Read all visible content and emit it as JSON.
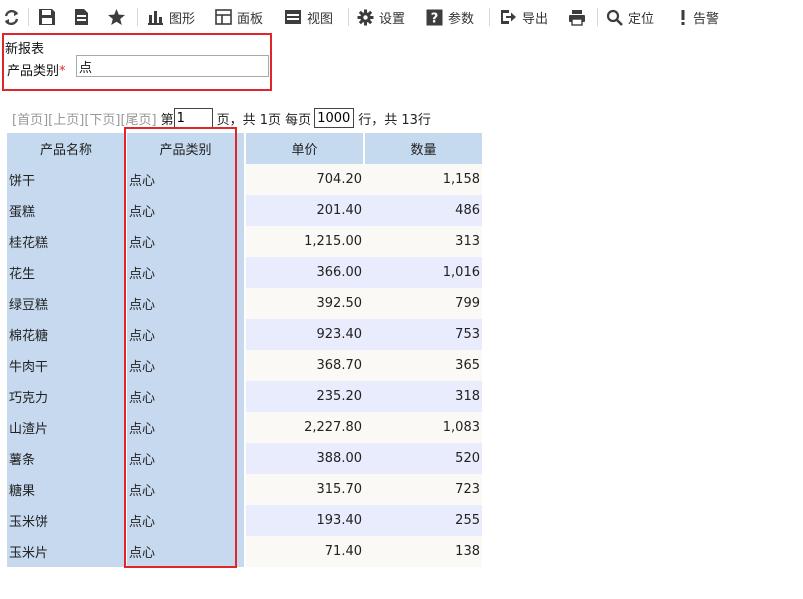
{
  "toolbar": {
    "chart": "图形",
    "dashboard": "面板",
    "view": "视图",
    "settings": "设置",
    "params": "参数",
    "export": "导出",
    "locate": "定位",
    "alert": "告警"
  },
  "param_panel": {
    "title": "新报表",
    "label": "产品类别",
    "required_mark": "*",
    "value": "点"
  },
  "pager": {
    "first": "[首页]",
    "prev": "[上页]",
    "next": "[下页]",
    "last": "[尾页]",
    "page_prefix": "第",
    "page_value": "1",
    "page_suffix": "页，共 1页 每页",
    "rows_value": "1000",
    "rows_suffix": "行，共 13行"
  },
  "table": {
    "columns": [
      "产品名称",
      "产品类别",
      "单价",
      "数量"
    ],
    "rows": [
      [
        "饼干",
        "点心",
        "704.20",
        "1,158"
      ],
      [
        "蛋糕",
        "点心",
        "201.40",
        "486"
      ],
      [
        "桂花糕",
        "点心",
        "1,215.00",
        "313"
      ],
      [
        "花生",
        "点心",
        "366.00",
        "1,016"
      ],
      [
        "绿豆糕",
        "点心",
        "392.50",
        "799"
      ],
      [
        "棉花糖",
        "点心",
        "923.40",
        "753"
      ],
      [
        "牛肉干",
        "点心",
        "368.70",
        "365"
      ],
      [
        "巧克力",
        "点心",
        "235.20",
        "318"
      ],
      [
        "山渣片",
        "点心",
        "2,227.80",
        "1,083"
      ],
      [
        "薯条",
        "点心",
        "388.00",
        "520"
      ],
      [
        "糖果",
        "点心",
        "315.70",
        "723"
      ],
      [
        "玉米饼",
        "点心",
        "193.40",
        "255"
      ],
      [
        "玉米片",
        "点心",
        "71.40",
        "138"
      ]
    ]
  },
  "colors": {
    "highlight_border": "#e0262b",
    "header_bg": "#c5d9ef",
    "row_odd": "#faf9f5",
    "row_even": "#e8ecfc"
  }
}
